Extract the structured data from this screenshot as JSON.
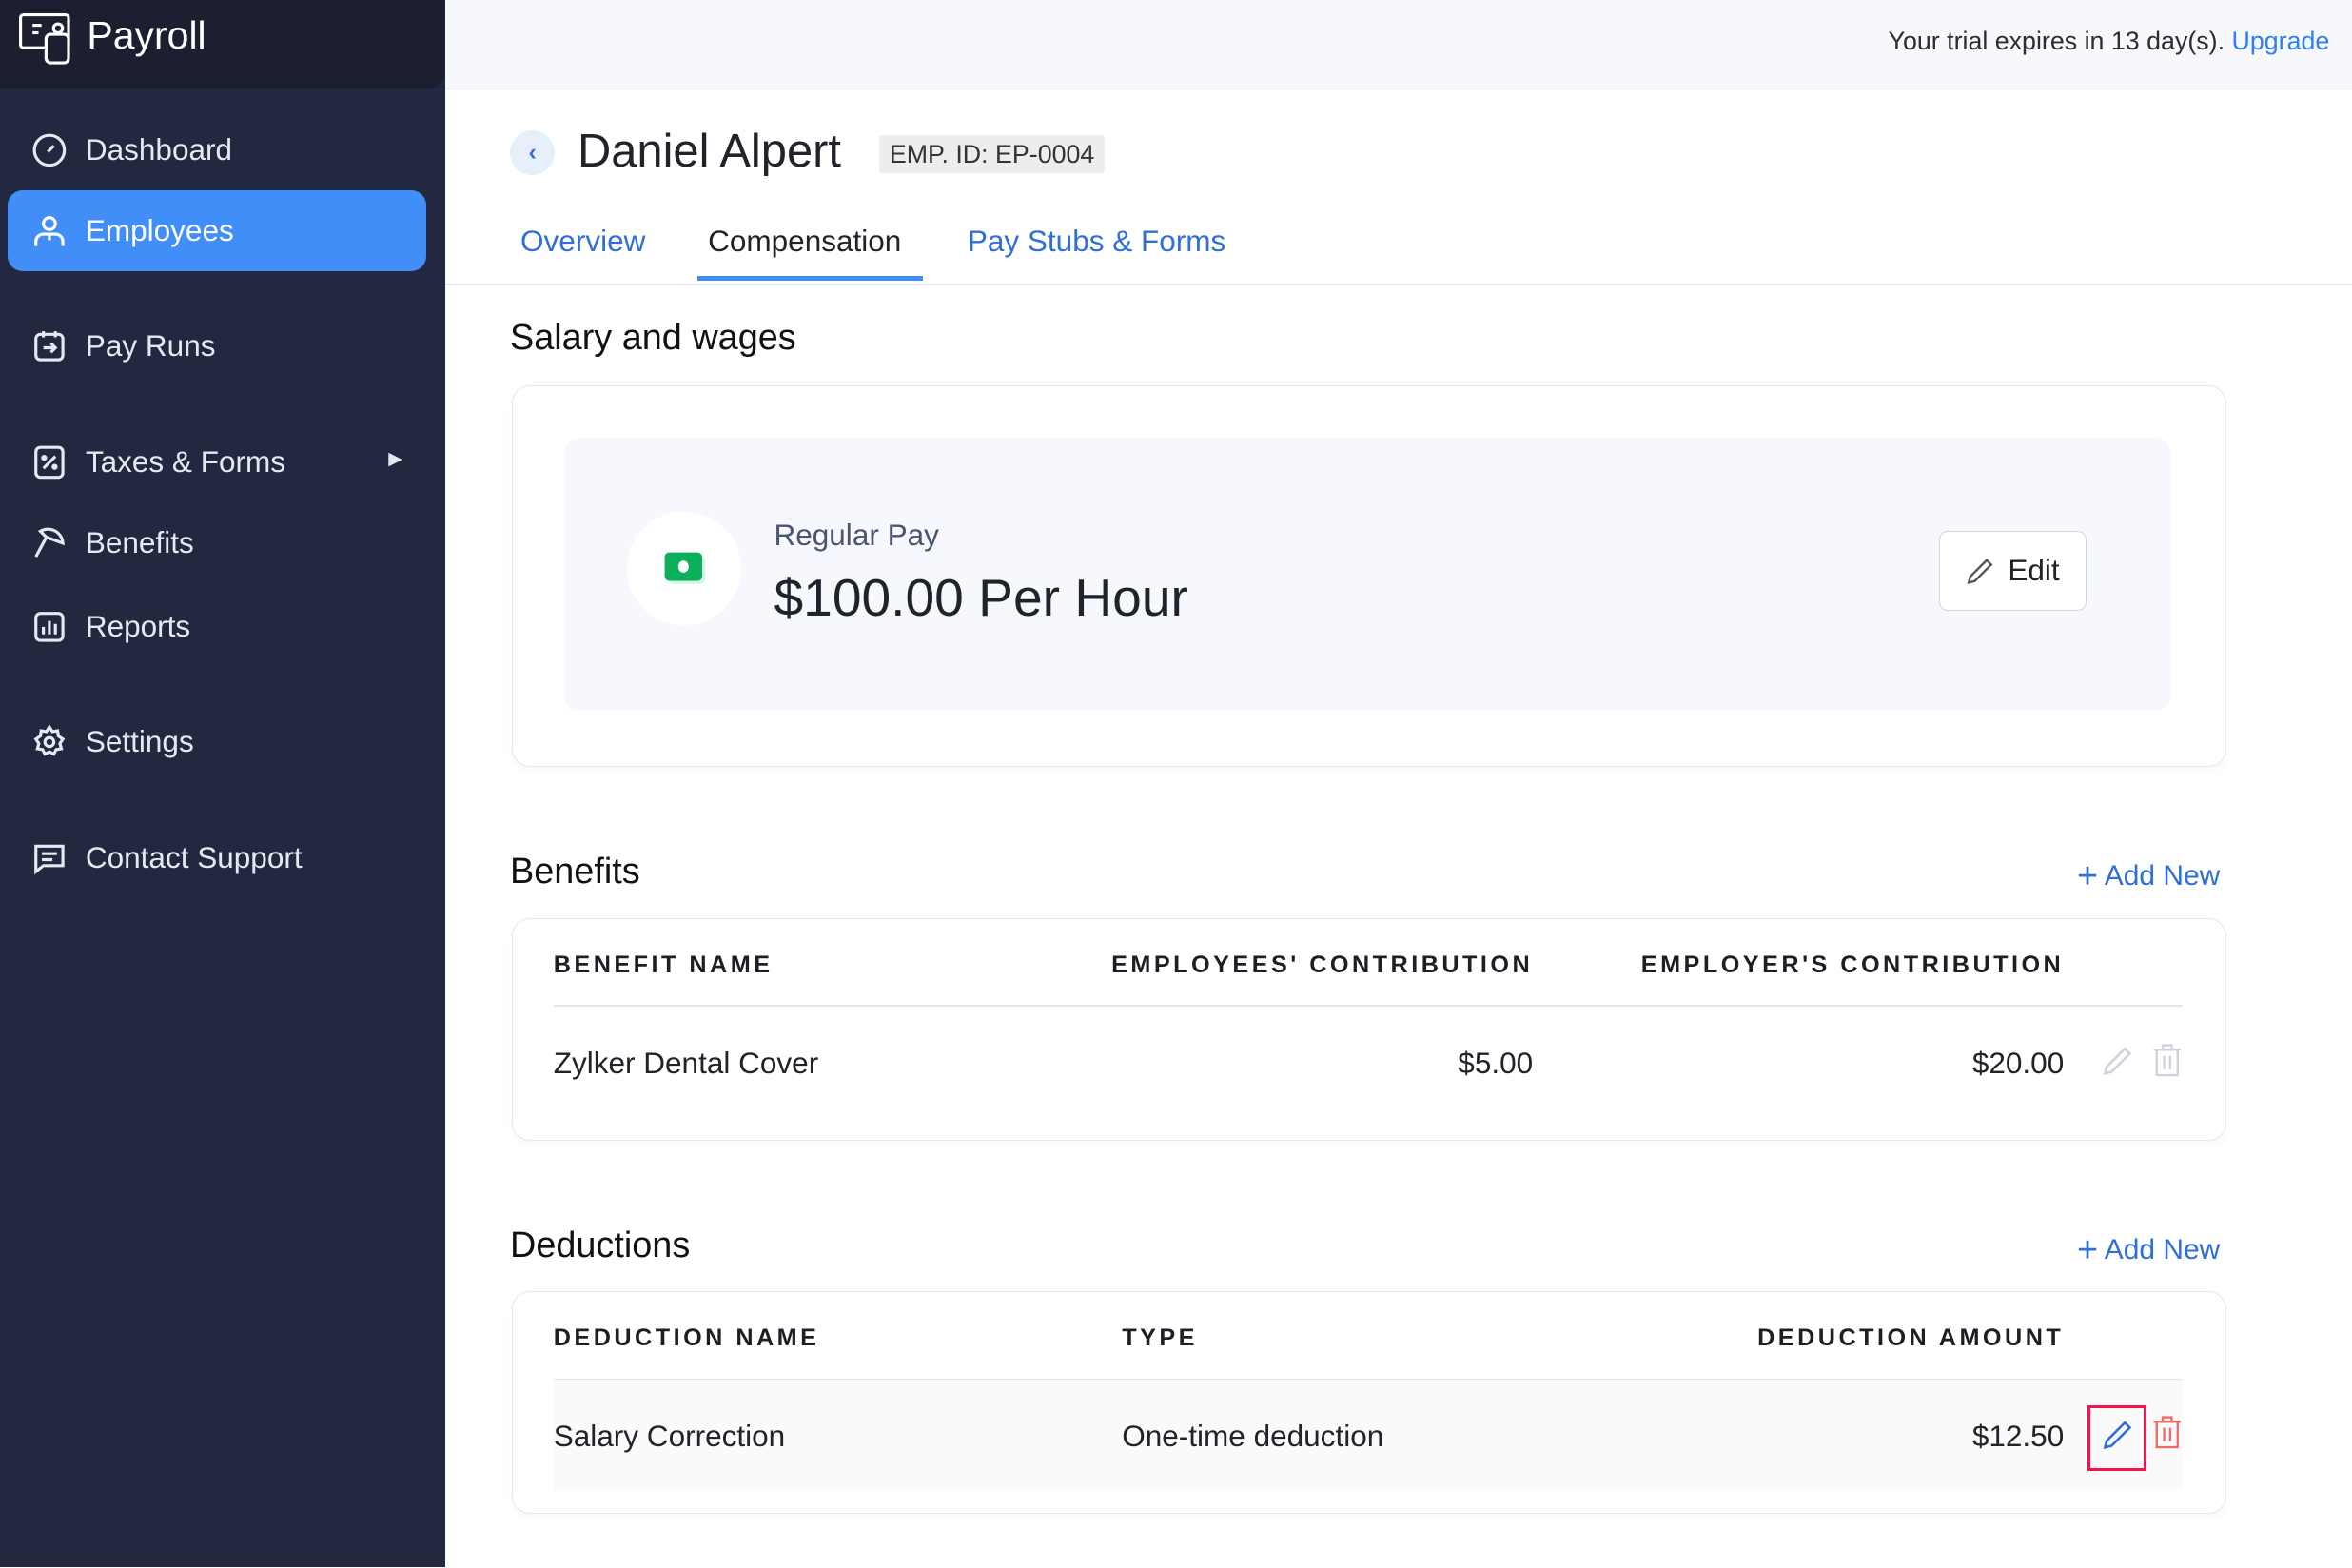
{
  "app": {
    "title": "Payroll"
  },
  "sidebar": {
    "items": [
      {
        "label": "Dashboard",
        "icon": "gauge-icon"
      },
      {
        "label": "Employees",
        "icon": "user-icon",
        "active": true
      },
      {
        "label": "Pay Runs",
        "icon": "pay-runs-icon"
      },
      {
        "label": "Taxes & Forms",
        "icon": "tax-icon",
        "has_submenu": true
      },
      {
        "label": "Benefits",
        "icon": "umbrella-icon"
      },
      {
        "label": "Reports",
        "icon": "bar-chart-icon"
      },
      {
        "label": "Settings",
        "icon": "gear-icon"
      },
      {
        "label": "Contact Support",
        "icon": "chat-icon"
      }
    ]
  },
  "topbar": {
    "trial_text": "Your trial expires in 13 day(s).",
    "upgrade_label": "Upgrade"
  },
  "employee": {
    "name": "Daniel Alpert",
    "emp_id": "EMP. ID: EP-0004"
  },
  "tabs": [
    {
      "label": "Overview"
    },
    {
      "label": "Compensation",
      "active": true
    },
    {
      "label": "Pay Stubs & Forms"
    }
  ],
  "salary": {
    "heading": "Salary and wages",
    "label": "Regular Pay",
    "amount": "$100.00 Per Hour",
    "edit_label": "Edit"
  },
  "benefits": {
    "heading": "Benefits",
    "add_label": "Add New",
    "columns": [
      "BENEFIT NAME",
      "EMPLOYEES' CONTRIBUTION",
      "EMPLOYER'S CONTRIBUTION"
    ],
    "rows": [
      {
        "name": "Zylker Dental Cover",
        "employee": "$5.00",
        "employer": "$20.00"
      }
    ]
  },
  "deductions": {
    "heading": "Deductions",
    "add_label": "Add New",
    "columns": [
      "DEDUCTION NAME",
      "TYPE",
      "DEDUCTION AMOUNT"
    ],
    "rows": [
      {
        "name": "Salary Correction",
        "type": "One-time deduction",
        "amount": "$12.50"
      }
    ]
  },
  "colors": {
    "accent": "#428ef9",
    "link": "#2f6fd6",
    "sidebar": "#222840",
    "highlight": "#f0144c",
    "delete": "#f06a6a"
  }
}
